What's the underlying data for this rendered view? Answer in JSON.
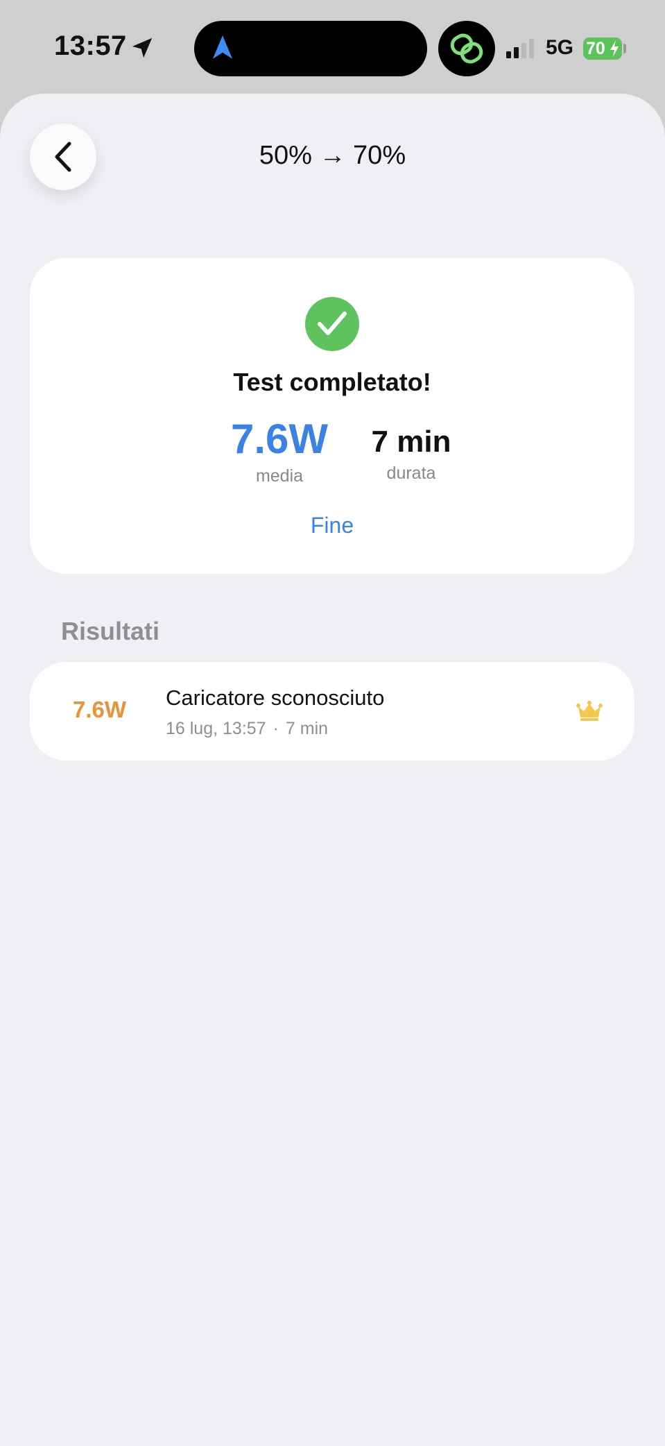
{
  "status_bar": {
    "time": "13:57",
    "network": "5G",
    "battery": "70"
  },
  "nav": {
    "title": "50% → 70%"
  },
  "result_card": {
    "heading": "Test completato!",
    "average_value": "7.6W",
    "average_label": "media",
    "duration_value": "7 min",
    "duration_label": "durata",
    "done_label": "Fine"
  },
  "results": {
    "header": "Risultati",
    "items": [
      {
        "watts": "7.6W",
        "name": "Caricatore sconosciuto",
        "date": "16 lug, 13:57",
        "separator": "·",
        "duration": "7 min"
      }
    ]
  },
  "colors": {
    "accent": "#3b82e6",
    "success": "#5ec25e",
    "watts_orange": "#e8923a",
    "crown_gold": "#f2c94c",
    "battery_green": "#5cc25a"
  },
  "icons": [
    "location-arrow-icon",
    "navigation-arrow-icon",
    "link-icon",
    "signal-icon",
    "battery-icon",
    "chevron-left-icon",
    "checkmark-icon",
    "crown-icon"
  ]
}
